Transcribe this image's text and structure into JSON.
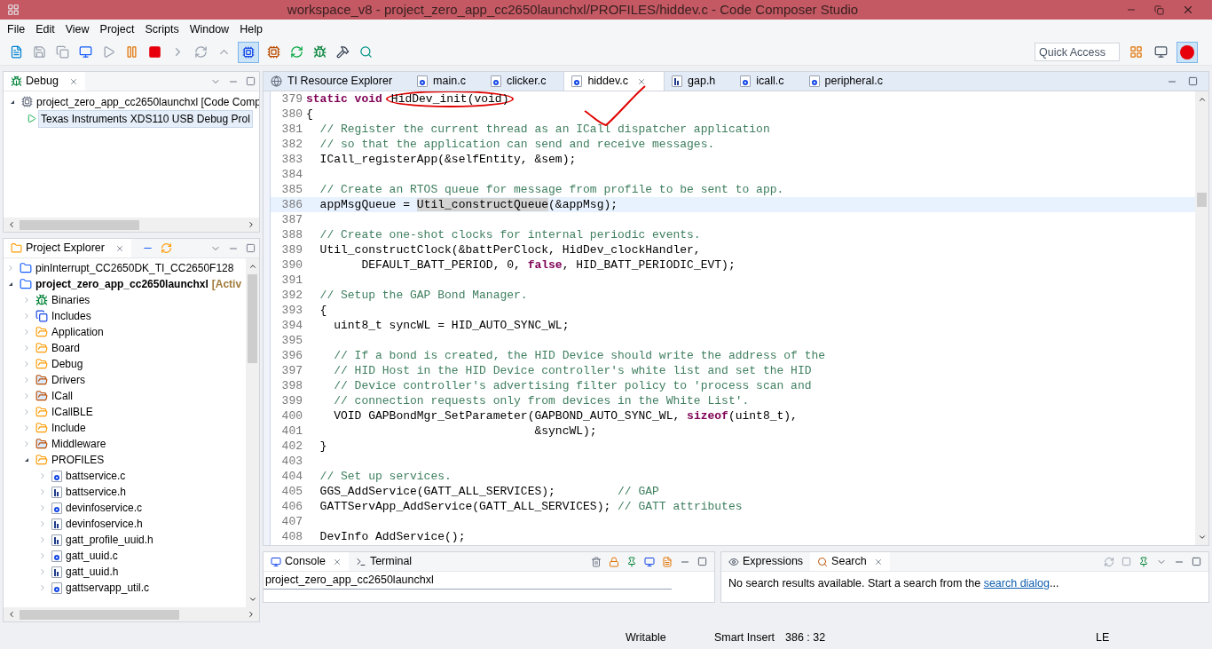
{
  "window": {
    "title": "workspace_v8 - project_zero_app_cc2650launchxl/PROFILES/hiddev.c - Code Composer Studio"
  },
  "menu": [
    "File",
    "Edit",
    "View",
    "Project",
    "Scripts",
    "Window",
    "Help"
  ],
  "quick_access": {
    "placeholder": "Quick Access"
  },
  "debug_view": {
    "title": "Debug",
    "items": [
      {
        "label": "project_zero_app_cc2650launchxl [Code Comp",
        "expanded": true,
        "selected": false,
        "children": [
          {
            "label": "Texas Instruments XDS110 USB Debug Prol",
            "selected": true
          }
        ]
      }
    ]
  },
  "project_explorer": {
    "title": "Project Explorer",
    "items": [
      {
        "label": "pinInterrupt_CC2650DK_TI_CC2650F128",
        "kind": "project",
        "expanded": false
      },
      {
        "label": "project_zero_app_cc2650launchxl",
        "suffix": "[Activ",
        "kind": "project",
        "expanded": true,
        "children": [
          {
            "label": "Binaries",
            "kind": "binaries",
            "expanded": false
          },
          {
            "label": "Includes",
            "kind": "includes",
            "expanded": false
          },
          {
            "label": "Application",
            "kind": "folder",
            "expanded": false
          },
          {
            "label": "Board",
            "kind": "folder",
            "expanded": false
          },
          {
            "label": "Debug",
            "kind": "folder",
            "expanded": false
          },
          {
            "label": "Drivers",
            "kind": "linked",
            "expanded": false
          },
          {
            "label": "ICall",
            "kind": "linked",
            "expanded": false
          },
          {
            "label": "ICallBLE",
            "kind": "folder",
            "expanded": false
          },
          {
            "label": "Include",
            "kind": "folder",
            "expanded": false
          },
          {
            "label": "Middleware",
            "kind": "linked",
            "expanded": false
          },
          {
            "label": "PROFILES",
            "kind": "folder",
            "expanded": true,
            "children": [
              {
                "label": "battservice.c",
                "kind": "c",
                "expanded": false
              },
              {
                "label": "battservice.h",
                "kind": "h",
                "expanded": false
              },
              {
                "label": "devinfoservice.c",
                "kind": "c",
                "expanded": false
              },
              {
                "label": "devinfoservice.h",
                "kind": "h",
                "expanded": false
              },
              {
                "label": "gatt_profile_uuid.h",
                "kind": "h",
                "expanded": false
              },
              {
                "label": "gatt_uuid.c",
                "kind": "c",
                "expanded": false
              },
              {
                "label": "gatt_uuid.h",
                "kind": "h",
                "expanded": false
              },
              {
                "label": "gattservapp_util.c",
                "kind": "c",
                "expanded": false
              }
            ]
          }
        ]
      }
    ]
  },
  "editor": {
    "tabs": [
      {
        "label": "TI Resource Explorer",
        "kind": "web",
        "selected": false
      },
      {
        "label": "main.c",
        "kind": "c",
        "selected": false
      },
      {
        "label": "clicker.c",
        "kind": "c",
        "selected": false
      },
      {
        "label": "hiddev.c",
        "kind": "c",
        "selected": true
      },
      {
        "label": "gap.h",
        "kind": "h",
        "selected": false
      },
      {
        "label": "icall.c",
        "kind": "c",
        "selected": false
      },
      {
        "label": "peripheral.c",
        "kind": "c",
        "selected": false
      }
    ],
    "lines": [
      {
        "number": "379",
        "current": false,
        "segments": [
          {
            "text": "static void",
            "kind": "keyword"
          },
          {
            "text": "HidDev_init(void)",
            "kind": "circled"
          }
        ]
      },
      {
        "number": "380",
        "current": false,
        "segments": [
          {
            "text": "{",
            "kind": "code"
          }
        ]
      },
      {
        "number": "381",
        "current": false,
        "segments": [
          {
            "text": "  // Register the current thread as an ICall dispatcher application",
            "kind": "comment"
          }
        ]
      },
      {
        "number": "382",
        "current": false,
        "segments": [
          {
            "text": "  // so that the application can send and receive messages.",
            "kind": "comment"
          }
        ]
      },
      {
        "number": "383",
        "current": false,
        "segments": [
          {
            "text": "  ICall_registerApp(&selfEntity, &sem);",
            "kind": "code"
          }
        ]
      },
      {
        "number": "384",
        "current": false
      },
      {
        "number": "385",
        "current": false,
        "segments": [
          {
            "text": "  // Create an RTOS queue for message from profile to be sent to app.",
            "kind": "comment"
          }
        ]
      },
      {
        "number": "386",
        "current": true,
        "segments": [
          {
            "text": "  appMsgQueue = ",
            "kind": "code"
          },
          {
            "text": "Util_constructQueue",
            "kind": "occurrence"
          },
          {
            "text": "(&appMsg);",
            "kind": "code"
          }
        ]
      },
      {
        "number": "387",
        "current": false
      },
      {
        "number": "388",
        "current": false,
        "segments": [
          {
            "text": "  // Create one-shot clocks for internal periodic events.",
            "kind": "comment"
          }
        ]
      },
      {
        "number": "389",
        "current": false,
        "segments": [
          {
            "text": "  Util_constructClock(&battPerClock, HidDev_clockHandler,",
            "kind": "code"
          }
        ]
      },
      {
        "number": "390",
        "current": false,
        "segments": [
          {
            "text": "        DEFAULT_BATT_PERIOD, 0, ",
            "kind": "code"
          },
          {
            "text": "false",
            "kind": "keyword"
          },
          {
            "text": ", HID_BATT_PERIODIC_EVT);",
            "kind": "code"
          }
        ]
      },
      {
        "number": "391",
        "current": false
      },
      {
        "number": "392",
        "current": false,
        "segments": [
          {
            "text": "  // Setup the GAP Bond Manager.",
            "kind": "comment"
          }
        ]
      },
      {
        "number": "393",
        "current": false,
        "segments": [
          {
            "text": "  {",
            "kind": "code"
          }
        ]
      },
      {
        "number": "394",
        "current": false,
        "segments": [
          {
            "text": "    uint8_t syncWL = HID_AUTO_SYNC_WL;",
            "kind": "code"
          }
        ]
      },
      {
        "number": "395",
        "current": false
      },
      {
        "number": "396",
        "current": false,
        "segments": [
          {
            "text": "    // If a bond is created, the HID Device should write the address of the",
            "kind": "comment"
          }
        ]
      },
      {
        "number": "397",
        "current": false,
        "segments": [
          {
            "text": "    // HID Host in the HID Device controller's white list and set the HID",
            "kind": "comment"
          }
        ]
      },
      {
        "number": "398",
        "current": false,
        "segments": [
          {
            "text": "    // Device controller's advertising filter policy to 'process scan and",
            "kind": "comment"
          }
        ]
      },
      {
        "number": "399",
        "current": false,
        "segments": [
          {
            "text": "    // connection requests only from devices in the White List'.",
            "kind": "comment"
          }
        ]
      },
      {
        "number": "400",
        "current": false,
        "segments": [
          {
            "text": "    VOID GAPBondMgr_SetParameter(GAPBOND_AUTO_SYNC_WL, ",
            "kind": "code"
          },
          {
            "text": "sizeof",
            "kind": "keyword"
          },
          {
            "text": "(uint8_t),",
            "kind": "code"
          }
        ]
      },
      {
        "number": "401",
        "current": false,
        "segments": [
          {
            "text": "                                 &syncWL);",
            "kind": "code"
          }
        ]
      },
      {
        "number": "402",
        "current": false,
        "segments": [
          {
            "text": "  }",
            "kind": "code"
          }
        ]
      },
      {
        "number": "403",
        "current": false
      },
      {
        "number": "404",
        "current": false,
        "segments": [
          {
            "text": "  // Set up services.",
            "kind": "comment"
          }
        ]
      },
      {
        "number": "405",
        "current": false,
        "segments": [
          {
            "text": "  GGS_AddService(GATT_ALL_SERVICES);",
            "kind": "code"
          },
          {
            "text": "         // GAP",
            "kind": "comment"
          }
        ]
      },
      {
        "number": "406",
        "current": false,
        "segments": [
          {
            "text": "  GATTServApp_AddService(GATT_ALL_SERVICES);",
            "kind": "code"
          },
          {
            "text": " // GATT attributes",
            "kind": "comment"
          }
        ]
      },
      {
        "number": "407",
        "current": false
      },
      {
        "number": "408",
        "current": false,
        "segments": [
          {
            "text": "  DevInfo AddService();",
            "kind": "code"
          }
        ]
      }
    ]
  },
  "console": {
    "tabs": [
      {
        "label": "Console",
        "selected": true
      },
      {
        "label": "Terminal",
        "selected": false
      }
    ],
    "text": "project_zero_app_cc2650launchxl"
  },
  "search_view": {
    "tabs": [
      {
        "label": "Expressions",
        "selected": false
      },
      {
        "label": "Search",
        "selected": true
      }
    ],
    "message": "No search results available. Start a search from the ",
    "link": "search dialog",
    "after": "..."
  },
  "status_bar": {
    "mode": "Writable",
    "insert": "Smart Insert",
    "position": "386 : 32",
    "encoding": "LE"
  }
}
